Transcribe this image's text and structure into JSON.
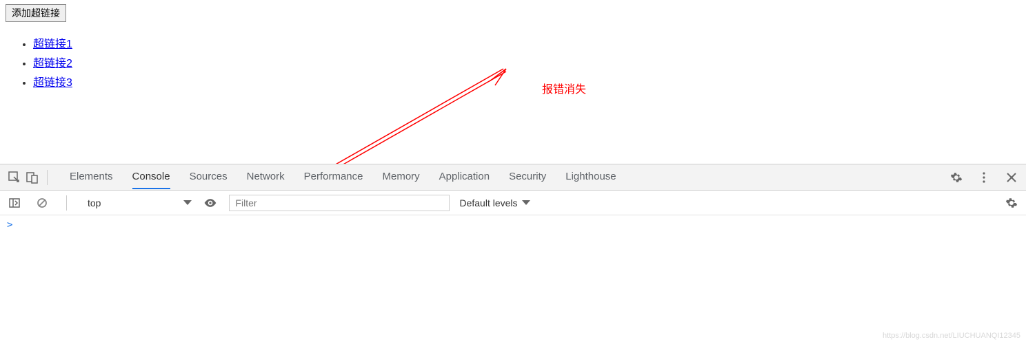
{
  "page": {
    "add_button": "添加超链接",
    "links": [
      "超链接1",
      "超链接2",
      "超链接3"
    ]
  },
  "annotation": {
    "text": "报错消失"
  },
  "devtools": {
    "tabs": [
      "Elements",
      "Console",
      "Sources",
      "Network",
      "Performance",
      "Memory",
      "Application",
      "Security",
      "Lighthouse"
    ],
    "active_tab": "Console",
    "console": {
      "context": "top",
      "filter_placeholder": "Filter",
      "levels": "Default levels",
      "prompt": ">"
    }
  },
  "watermark": "https://blog.csdn.net/LIUCHUANQI12345"
}
